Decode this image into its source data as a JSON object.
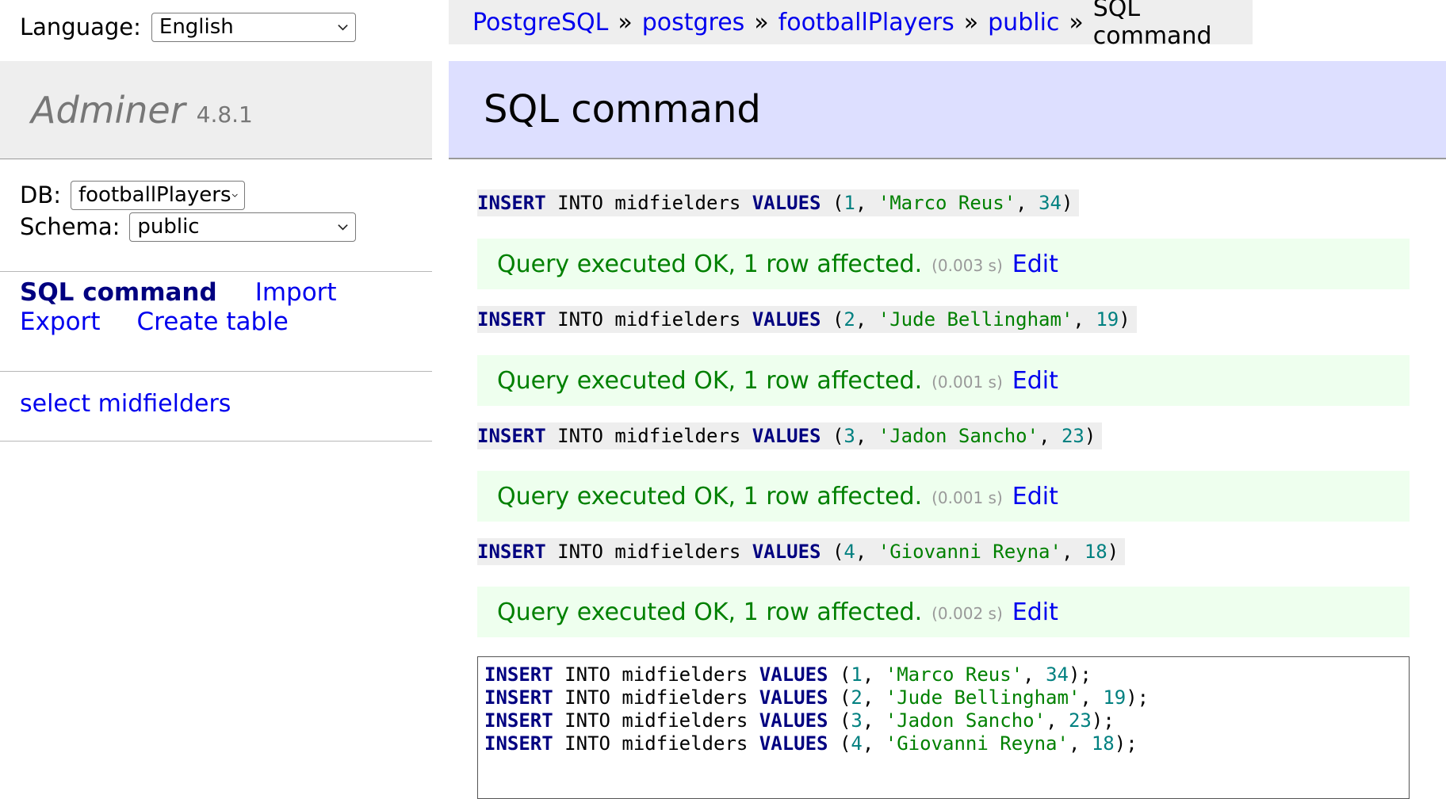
{
  "language": {
    "label": "Language:",
    "selected": "English"
  },
  "app": {
    "name": "Adminer",
    "version": "4.8.1"
  },
  "db_form": {
    "db_label": "DB:",
    "db_selected": "footballPlayers",
    "schema_label": "Schema:",
    "schema_selected": "public"
  },
  "menu": {
    "sql_command": "SQL command",
    "import": "Import",
    "export": "Export",
    "create_table": "Create table"
  },
  "tables": [
    {
      "label": "select midfielders"
    }
  ],
  "breadcrumb": {
    "items": [
      "PostgreSQL",
      "postgres",
      "footballPlayers",
      "public"
    ],
    "separator": "»",
    "current": "SQL command"
  },
  "page_title": "SQL command",
  "results": [
    {
      "id": "1",
      "name": "'Marco Reus'",
      "age": "34",
      "message": "Query executed OK, 1 row affected.",
      "time": "(0.003 s)",
      "edit": "Edit"
    },
    {
      "id": "2",
      "name": "'Jude Bellingham'",
      "age": "19",
      "message": "Query executed OK, 1 row affected.",
      "time": "(0.001 s)",
      "edit": "Edit"
    },
    {
      "id": "3",
      "name": "'Jadon Sancho'",
      "age": "23",
      "message": "Query executed OK, 1 row affected.",
      "time": "(0.001 s)",
      "edit": "Edit"
    },
    {
      "id": "4",
      "name": "'Giovanni Reyna'",
      "age": "18",
      "message": "Query executed OK, 1 row affected.",
      "time": "(0.002 s)",
      "edit": "Edit"
    }
  ],
  "sql": {
    "kw_insert": "INSERT",
    "into_table": " INTO midfielders ",
    "kw_values": "VALUES"
  },
  "colors": {
    "link": "#0000ee",
    "keyword": "#000080",
    "number": "#008080",
    "string": "#008000",
    "success_bg": "#eeffee",
    "header_bg": "#dddfff"
  }
}
